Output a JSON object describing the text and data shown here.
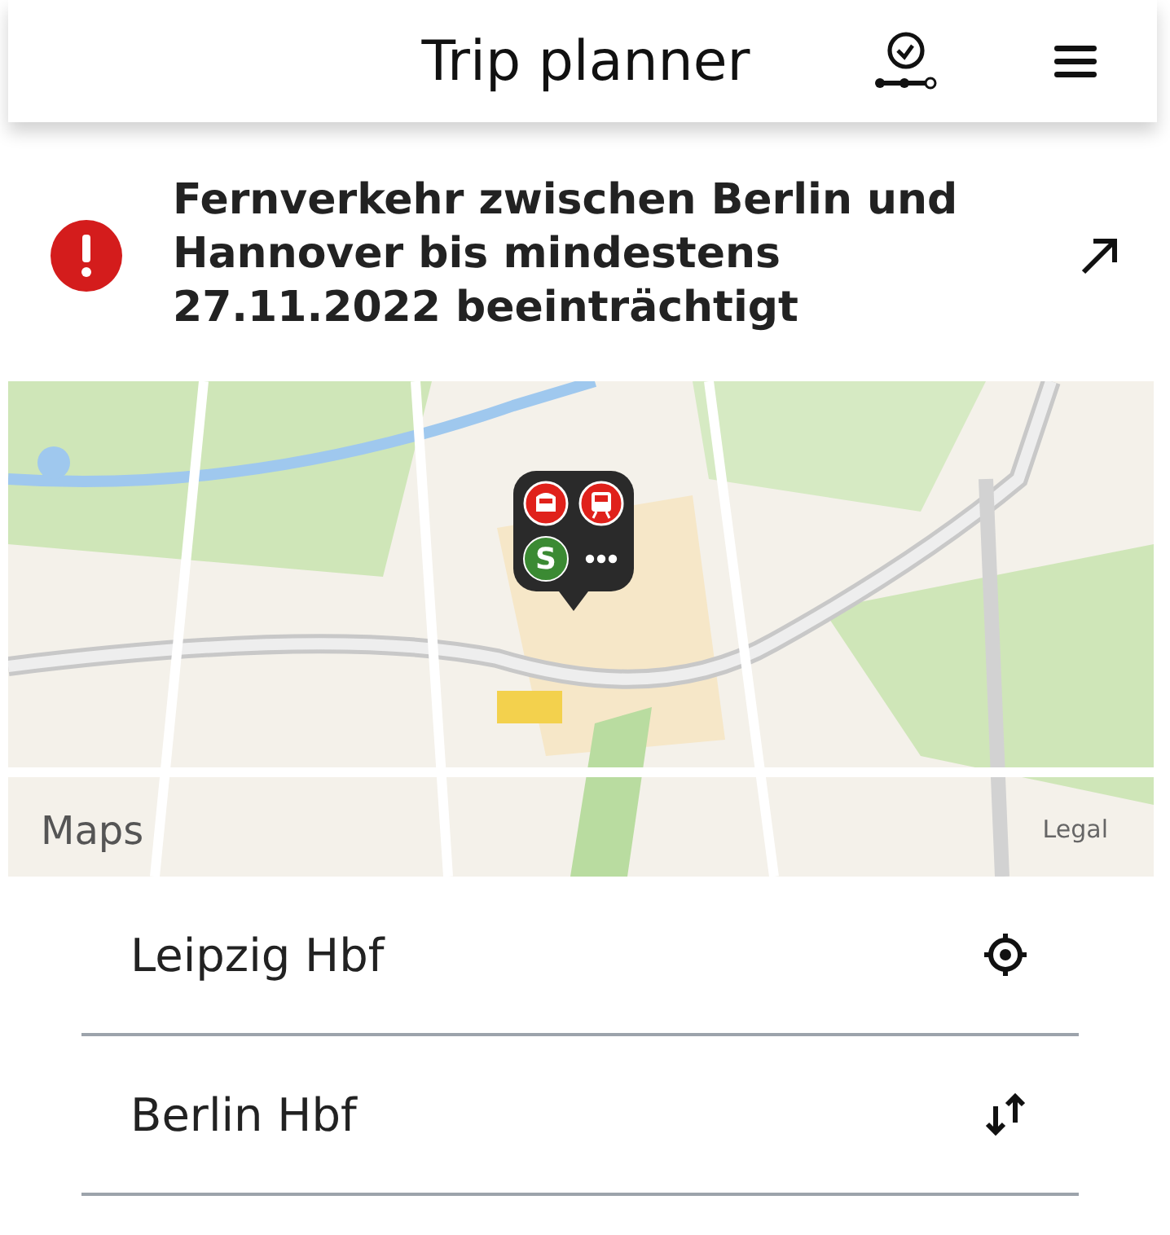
{
  "header": {
    "title": "Trip planner"
  },
  "alert": {
    "text": "Fernverkehr zwischen Berlin und Hannover bis mindestens 27.11.2022 beeinträchtigt"
  },
  "map": {
    "attribution": "Maps",
    "legal": "Legal",
    "marker": {
      "badges": [
        {
          "kind": "long_distance"
        },
        {
          "kind": "regional"
        },
        {
          "kind": "sbahn",
          "label": "S"
        },
        {
          "kind": "more"
        }
      ]
    }
  },
  "fields": [
    {
      "kind": "origin",
      "value": "Leipzig Hbf"
    },
    {
      "kind": "destination",
      "value": "Berlin Hbf"
    }
  ]
}
